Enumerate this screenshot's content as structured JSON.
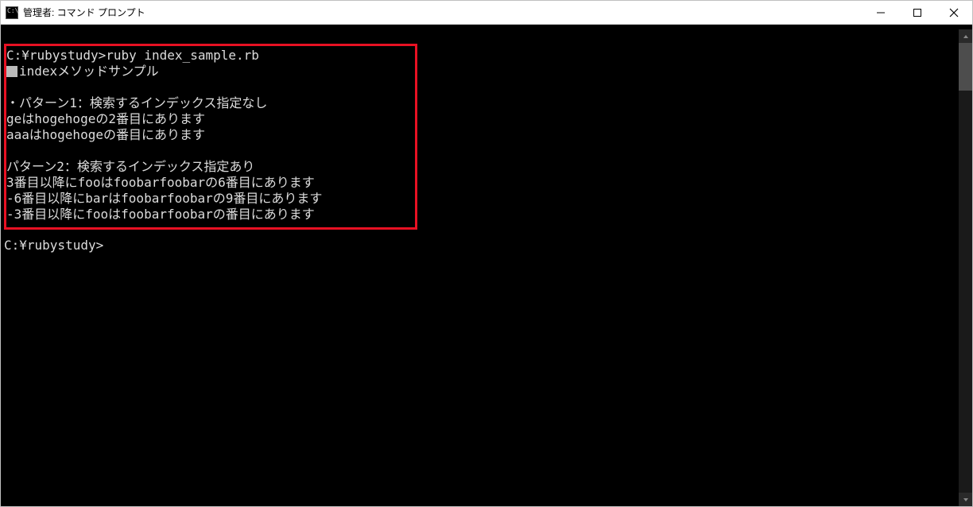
{
  "window": {
    "title": "管理者: コマンド プロンプト"
  },
  "redbox": {
    "line1": "C:¥rubystudy>ruby index_sample.rb",
    "line2_after": "indexメソッドサンプル",
    "line4": "・パターン1：検索するインデックス指定なし",
    "line5": "geはhogehogeの2番目にあります",
    "line6": "aaaはhogehogeの番目にあります",
    "line8": "パターン2：検索するインデックス指定あり",
    "line9": "3番目以降にfooはfoobarfoobarの6番目にあります",
    "line10": "-6番目以降にbarはfoobarfoobarの9番目にあります",
    "line11": "-3番目以降にfooはfoobarfoobarの番目にあります"
  },
  "after": {
    "prompt": "C:¥rubystudy>"
  }
}
